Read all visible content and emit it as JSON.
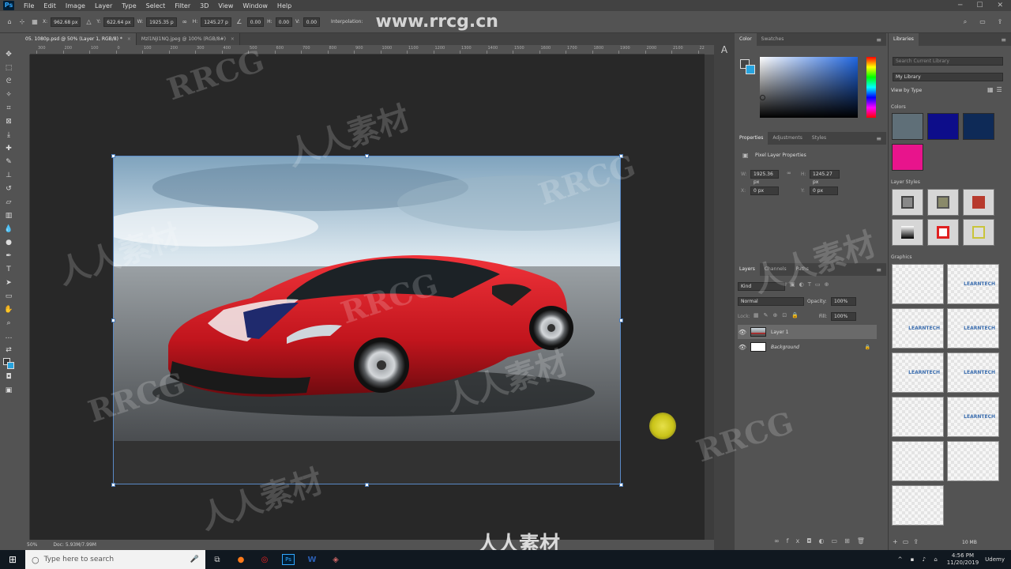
{
  "menu": [
    "File",
    "Edit",
    "Image",
    "Layer",
    "Type",
    "Select",
    "Filter",
    "3D",
    "View",
    "Window",
    "Help"
  ],
  "app_logo": "Ps",
  "options": {
    "x_label": "X:",
    "x_value": "962.68 px",
    "y_label": "Y:",
    "y_value": "622.64 px",
    "w_label": "W:",
    "w_value": "1925.35 p",
    "h_label": "H:",
    "h_value": "1245.27 p",
    "angle_value": "0.00",
    "hskew_label": "H:",
    "hskew_value": "0.00",
    "vskew_label": "V:",
    "vskew_value": "0.00",
    "interp_label": "Interpolation:",
    "watermark_url": "www.rrcg.cn"
  },
  "tabs": [
    {
      "label": "05. 1080p.psd @ 50% (Layer 1, RGB/8) *",
      "active": true
    },
    {
      "label": "Mzl1NjI1NQ.jpeg @ 100% (RGB/8#)",
      "active": false
    }
  ],
  "ruler_ticks": [
    "300",
    "200",
    "100",
    "0",
    "100",
    "200",
    "300",
    "400",
    "500",
    "600",
    "700",
    "800",
    "900",
    "1000",
    "1100",
    "1200",
    "1300",
    "1400",
    "1500",
    "1600",
    "1700",
    "1800",
    "1900",
    "2000",
    "2100",
    "2200"
  ],
  "status": {
    "zoom": "50%",
    "doc": "Doc: 5.93M/7.99M"
  },
  "color_panel": {
    "tabs": [
      "Color",
      "Swatches"
    ]
  },
  "properties": {
    "tabs": [
      "Properties",
      "Adjustments",
      "Styles"
    ],
    "title": "Pixel Layer Properties",
    "w_label": "W:",
    "w_value": "1925.36 px",
    "h_label": "H:",
    "h_value": "1245.27 px",
    "x_label": "X:",
    "x_value": "0 px",
    "y_label": "Y:",
    "y_value": "0 px"
  },
  "layers": {
    "tabs": [
      "Layers",
      "Channels",
      "Paths"
    ],
    "kind_placeholder": "Kind",
    "blend_mode": "Normal",
    "opacity_label": "Opacity:",
    "opacity_value": "100%",
    "lock_label": "Lock:",
    "fill_label": "Fill:",
    "fill_value": "100%",
    "items": [
      {
        "name": "Layer 1"
      },
      {
        "name": "Background"
      }
    ]
  },
  "libraries": {
    "title": "Libraries",
    "search_placeholder": "Search Current Library",
    "library_name": "My Library",
    "view_by": "View by Type",
    "colors_label": "Colors",
    "colors": [
      "#5f6f78",
      "#0d0d8a",
      "#0e2a57",
      "#e8148c"
    ],
    "layer_styles_label": "Layer Styles",
    "graphics_label": "Graphics",
    "graphic_label": "LEARNTECH",
    "size": "10 MB"
  },
  "taskbar": {
    "search_placeholder": "Type here to search",
    "time": "4:56 PM",
    "date": "11/20/2019",
    "brand": "Udemy"
  },
  "watermarks": {
    "rrcg": "RRCG",
    "cn": "人人素材"
  }
}
